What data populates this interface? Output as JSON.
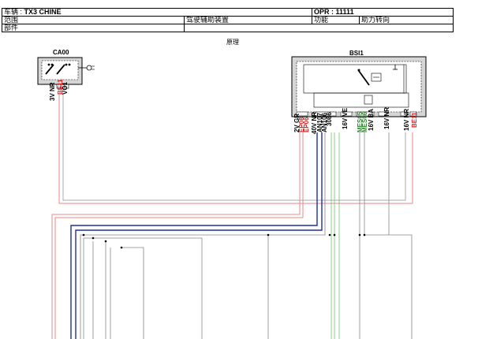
{
  "header": {
    "vehicle_label": "车辆",
    "vehicle_value": "TX3 CHINE",
    "opr_label": "OPR",
    "opr_value": "11111",
    "scope_label": "范围",
    "scope_value": "驾驶辅助装置",
    "function_label": "功能",
    "function_value": "助力转向",
    "part_label": "部件",
    "principle_label": "原理"
  },
  "components": {
    "left_title": "CA00",
    "right_title": "BSI1"
  },
  "pins": {
    "ca00": [
      "3V NR",
      "BE11",
      "VO1"
    ],
    "bsi1": [
      "2V GR",
      "EP08",
      "EP06",
      "40V NR",
      "AN107",
      "AN106",
      "3086",
      "16V VE",
      "MES05",
      "MES06",
      "16V BA",
      "16V NR",
      "16V NR",
      "BE11"
    ]
  },
  "colors": {
    "wire_red": "#e88888",
    "wire_blue": "#1f2e9e",
    "wire_green": "#6cc46c",
    "wire_gray": "#888888"
  }
}
